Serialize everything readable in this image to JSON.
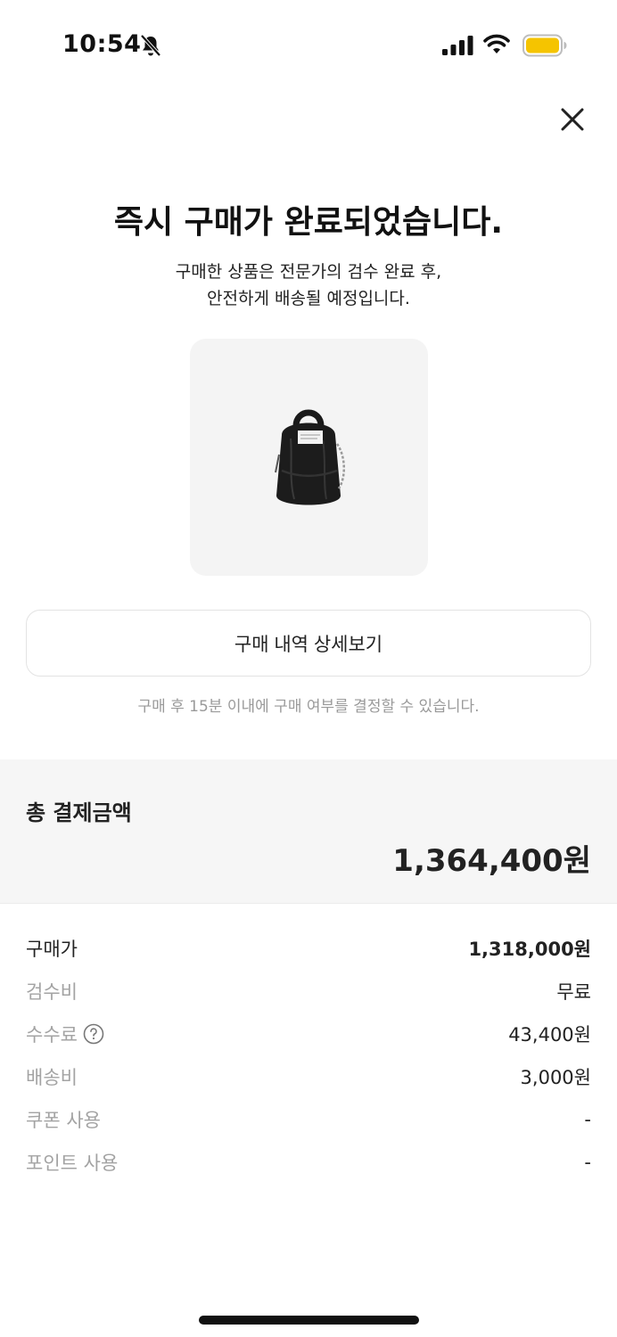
{
  "status_bar": {
    "time": "10:54",
    "icons": [
      "bell-muted-icon",
      "signal-icon",
      "wifi-icon",
      "battery-icon"
    ],
    "battery_color": "#F5C400"
  },
  "header": {
    "close_icon": "close-icon"
  },
  "confirmation": {
    "title": "즉시 구매가 완료되었습니다.",
    "subtitle_line1": "구매한 상품은 전문가의 검수 완료 후,",
    "subtitle_line2": "안전하게 배송될 예정입니다."
  },
  "product": {
    "image_icon": "backpack-image"
  },
  "actions": {
    "detail_button_label": "구매 내역 상세보기",
    "notice": "구매 후 15분 이내에 구매 여부를 결정할 수 있습니다."
  },
  "total": {
    "label": "총 결제금액",
    "amount": "1,364,400원"
  },
  "breakdown": [
    {
      "label": "구매가",
      "value": "1,318,000원"
    },
    {
      "label": "검수비",
      "value": "무료"
    },
    {
      "label": "수수료",
      "value": "43,400원"
    },
    {
      "label": "배송비",
      "value": "3,000원"
    },
    {
      "label": "쿠폰 사용",
      "value": "-"
    },
    {
      "label": "포인트 사용",
      "value": "-"
    }
  ]
}
